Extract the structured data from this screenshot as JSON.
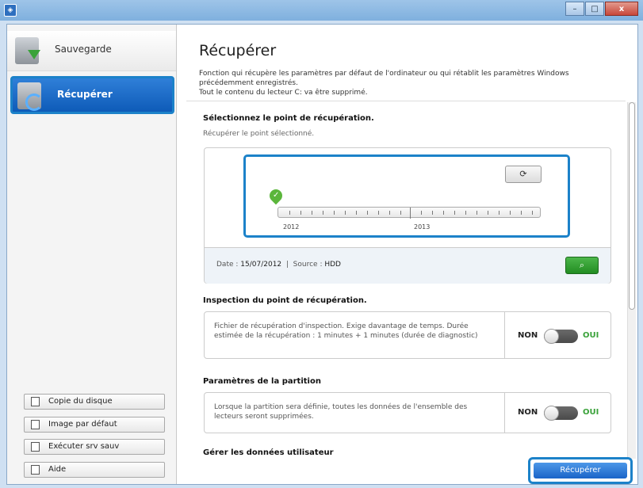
{
  "window": {
    "close_label": "x",
    "min_label": "–",
    "max_label": "□"
  },
  "sidebar": {
    "items": [
      {
        "label": "Sauvegarde",
        "icon": "backup-icon"
      },
      {
        "label": "Récupérer",
        "icon": "restore-icon"
      }
    ],
    "buttons": [
      {
        "label": "Copie du disque",
        "icon": "copy-disk-icon"
      },
      {
        "label": "Image par défaut",
        "icon": "default-image-icon"
      },
      {
        "label": "Exécuter srv sauv",
        "icon": "run-server-icon"
      },
      {
        "label": "Aide",
        "icon": "help-icon"
      }
    ]
  },
  "main": {
    "title": "Récupérer",
    "description_line1": "Fonction qui récupère les paramètres par défaut de l'ordinateur ou qui rétablit les paramètres Windows précédemment enregistrés.",
    "description_line2": "Tout le contenu du lecteur C: va être supprimé.",
    "point_section": {
      "title": "Sélectionnez le point de récupération.",
      "subtitle": "Récupérer le point sélectionné.",
      "years": [
        "2012",
        "2013"
      ],
      "date_label": "Date :",
      "date_value": "15/07/2012",
      "separator": "|",
      "source_label": "Source :",
      "source_value": "HDD"
    },
    "inspection": {
      "title": "Inspection du point de récupération.",
      "text": "Fichier de récupération d'inspection. Exige davantage de temps. Durée estimée de la récupération : 1 minutes + 1 minutes (durée de diagnostic)",
      "off_label": "NON",
      "on_label": "OUI"
    },
    "partition": {
      "title": "Paramètres de la partition",
      "text": "Lorsque la partition sera définie, toutes les données de l'ensemble des lecteurs seront supprimées.",
      "off_label": "NON",
      "on_label": "OUI"
    },
    "user_data": {
      "title": "Gérer les données utilisateur"
    },
    "action_button": "Récupérer"
  }
}
